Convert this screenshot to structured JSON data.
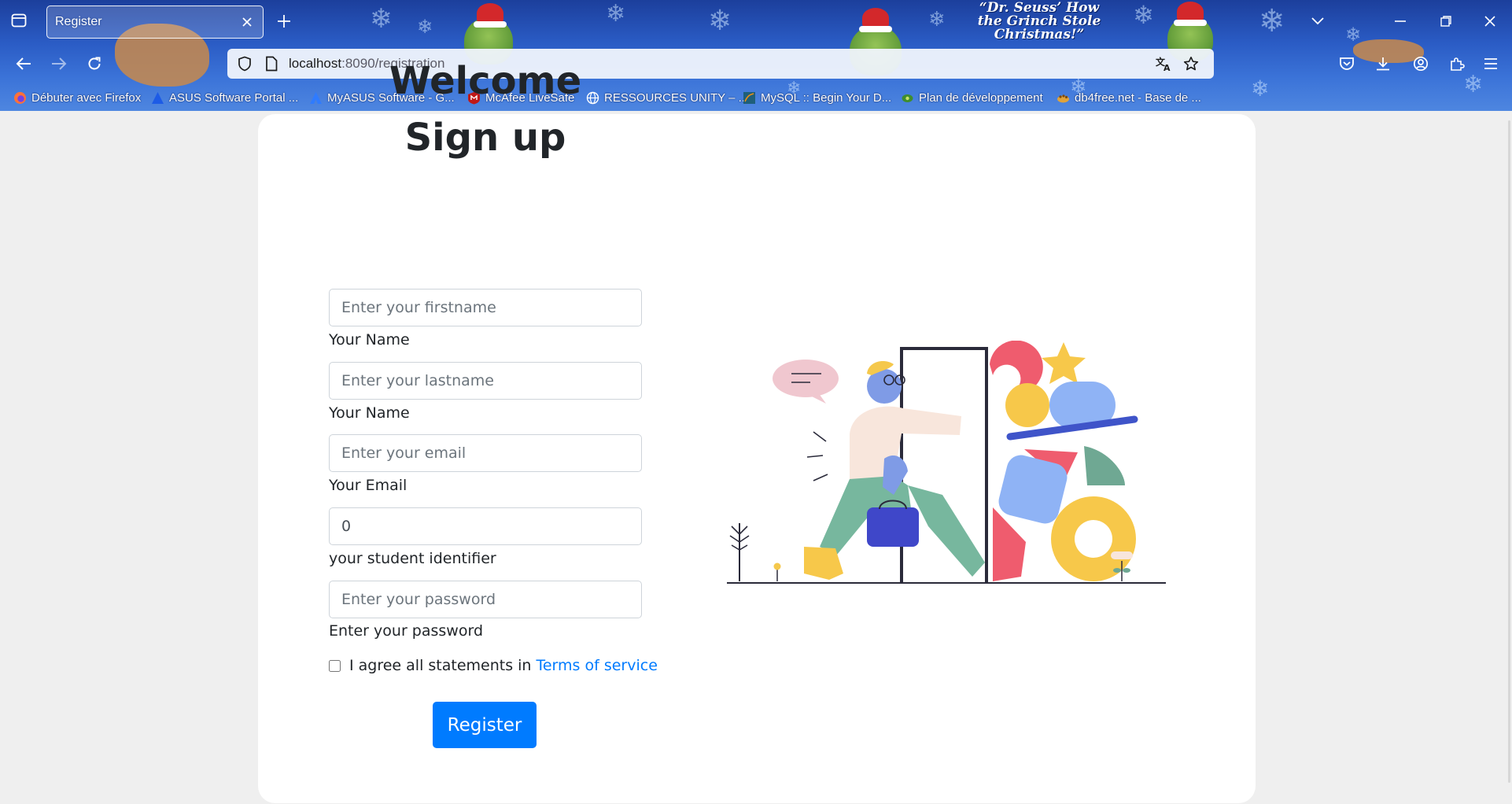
{
  "browser": {
    "theme_title": "“Dr. Seuss’ How the Grinch Stole Christmas!”",
    "tab": {
      "title": "Register"
    },
    "url": {
      "host": "localhost",
      "rest": ":8090/registration"
    },
    "bookmarks": [
      {
        "label": "Débuter avec Firefox",
        "icon": "firefox-icon"
      },
      {
        "label": "ASUS Software Portal ...",
        "icon": "asus-icon"
      },
      {
        "label": "MyASUS Software - G...",
        "icon": "myasus-icon"
      },
      {
        "label": "McAfee LiveSafe",
        "icon": "mcafee-icon"
      },
      {
        "label": "RESSOURCES UNITY – ...",
        "icon": "globe-icon"
      },
      {
        "label": "MySQL :: Begin Your D...",
        "icon": "mysql-icon"
      },
      {
        "label": "Plan de développement",
        "icon": "plan-icon"
      },
      {
        "label": "db4free.net - Base de ...",
        "icon": "db4free-icon"
      }
    ]
  },
  "form": {
    "heading_line1": "Welcome",
    "heading_line2": "Sign up",
    "firstname": {
      "placeholder": "Enter your firstname",
      "value": "",
      "label": "Your Name"
    },
    "lastname": {
      "placeholder": "Enter your lastname",
      "value": "",
      "label": "Your Name"
    },
    "email": {
      "placeholder": "Enter your email",
      "value": "",
      "label": "Your Email"
    },
    "student_id": {
      "placeholder": "",
      "value": "0",
      "label": "your student identifier"
    },
    "password": {
      "placeholder": "Enter your password",
      "value": "",
      "label": "Enter your password"
    },
    "terms_text": "I agree all statements in",
    "terms_link": "Terms of service",
    "submit_label": "Register"
  },
  "colors": {
    "primary": "#007bff",
    "text": "#212529",
    "page_bg": "#efefef",
    "chrome_bg": "#2a5bc4"
  }
}
